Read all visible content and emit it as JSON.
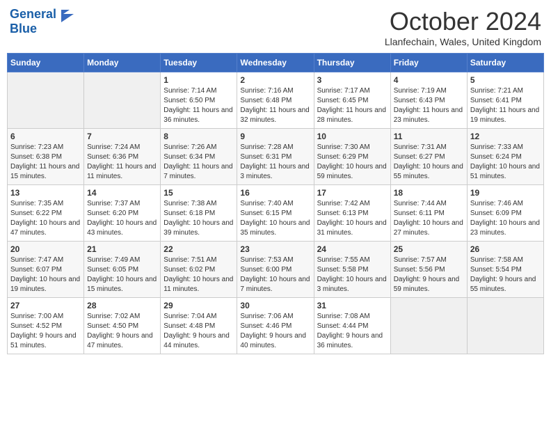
{
  "header": {
    "logo_line1": "General",
    "logo_line2": "Blue",
    "month_title": "October 2024",
    "location": "Llanfechain, Wales, United Kingdom"
  },
  "days_of_week": [
    "Sunday",
    "Monday",
    "Tuesday",
    "Wednesday",
    "Thursday",
    "Friday",
    "Saturday"
  ],
  "weeks": [
    [
      {
        "num": "",
        "info": ""
      },
      {
        "num": "",
        "info": ""
      },
      {
        "num": "1",
        "info": "Sunrise: 7:14 AM\nSunset: 6:50 PM\nDaylight: 11 hours and 36 minutes."
      },
      {
        "num": "2",
        "info": "Sunrise: 7:16 AM\nSunset: 6:48 PM\nDaylight: 11 hours and 32 minutes."
      },
      {
        "num": "3",
        "info": "Sunrise: 7:17 AM\nSunset: 6:45 PM\nDaylight: 11 hours and 28 minutes."
      },
      {
        "num": "4",
        "info": "Sunrise: 7:19 AM\nSunset: 6:43 PM\nDaylight: 11 hours and 23 minutes."
      },
      {
        "num": "5",
        "info": "Sunrise: 7:21 AM\nSunset: 6:41 PM\nDaylight: 11 hours and 19 minutes."
      }
    ],
    [
      {
        "num": "6",
        "info": "Sunrise: 7:23 AM\nSunset: 6:38 PM\nDaylight: 11 hours and 15 minutes."
      },
      {
        "num": "7",
        "info": "Sunrise: 7:24 AM\nSunset: 6:36 PM\nDaylight: 11 hours and 11 minutes."
      },
      {
        "num": "8",
        "info": "Sunrise: 7:26 AM\nSunset: 6:34 PM\nDaylight: 11 hours and 7 minutes."
      },
      {
        "num": "9",
        "info": "Sunrise: 7:28 AM\nSunset: 6:31 PM\nDaylight: 11 hours and 3 minutes."
      },
      {
        "num": "10",
        "info": "Sunrise: 7:30 AM\nSunset: 6:29 PM\nDaylight: 10 hours and 59 minutes."
      },
      {
        "num": "11",
        "info": "Sunrise: 7:31 AM\nSunset: 6:27 PM\nDaylight: 10 hours and 55 minutes."
      },
      {
        "num": "12",
        "info": "Sunrise: 7:33 AM\nSunset: 6:24 PM\nDaylight: 10 hours and 51 minutes."
      }
    ],
    [
      {
        "num": "13",
        "info": "Sunrise: 7:35 AM\nSunset: 6:22 PM\nDaylight: 10 hours and 47 minutes."
      },
      {
        "num": "14",
        "info": "Sunrise: 7:37 AM\nSunset: 6:20 PM\nDaylight: 10 hours and 43 minutes."
      },
      {
        "num": "15",
        "info": "Sunrise: 7:38 AM\nSunset: 6:18 PM\nDaylight: 10 hours and 39 minutes."
      },
      {
        "num": "16",
        "info": "Sunrise: 7:40 AM\nSunset: 6:15 PM\nDaylight: 10 hours and 35 minutes."
      },
      {
        "num": "17",
        "info": "Sunrise: 7:42 AM\nSunset: 6:13 PM\nDaylight: 10 hours and 31 minutes."
      },
      {
        "num": "18",
        "info": "Sunrise: 7:44 AM\nSunset: 6:11 PM\nDaylight: 10 hours and 27 minutes."
      },
      {
        "num": "19",
        "info": "Sunrise: 7:46 AM\nSunset: 6:09 PM\nDaylight: 10 hours and 23 minutes."
      }
    ],
    [
      {
        "num": "20",
        "info": "Sunrise: 7:47 AM\nSunset: 6:07 PM\nDaylight: 10 hours and 19 minutes."
      },
      {
        "num": "21",
        "info": "Sunrise: 7:49 AM\nSunset: 6:05 PM\nDaylight: 10 hours and 15 minutes."
      },
      {
        "num": "22",
        "info": "Sunrise: 7:51 AM\nSunset: 6:02 PM\nDaylight: 10 hours and 11 minutes."
      },
      {
        "num": "23",
        "info": "Sunrise: 7:53 AM\nSunset: 6:00 PM\nDaylight: 10 hours and 7 minutes."
      },
      {
        "num": "24",
        "info": "Sunrise: 7:55 AM\nSunset: 5:58 PM\nDaylight: 10 hours and 3 minutes."
      },
      {
        "num": "25",
        "info": "Sunrise: 7:57 AM\nSunset: 5:56 PM\nDaylight: 9 hours and 59 minutes."
      },
      {
        "num": "26",
        "info": "Sunrise: 7:58 AM\nSunset: 5:54 PM\nDaylight: 9 hours and 55 minutes."
      }
    ],
    [
      {
        "num": "27",
        "info": "Sunrise: 7:00 AM\nSunset: 4:52 PM\nDaylight: 9 hours and 51 minutes."
      },
      {
        "num": "28",
        "info": "Sunrise: 7:02 AM\nSunset: 4:50 PM\nDaylight: 9 hours and 47 minutes."
      },
      {
        "num": "29",
        "info": "Sunrise: 7:04 AM\nSunset: 4:48 PM\nDaylight: 9 hours and 44 minutes."
      },
      {
        "num": "30",
        "info": "Sunrise: 7:06 AM\nSunset: 4:46 PM\nDaylight: 9 hours and 40 minutes."
      },
      {
        "num": "31",
        "info": "Sunrise: 7:08 AM\nSunset: 4:44 PM\nDaylight: 9 hours and 36 minutes."
      },
      {
        "num": "",
        "info": ""
      },
      {
        "num": "",
        "info": ""
      }
    ]
  ]
}
